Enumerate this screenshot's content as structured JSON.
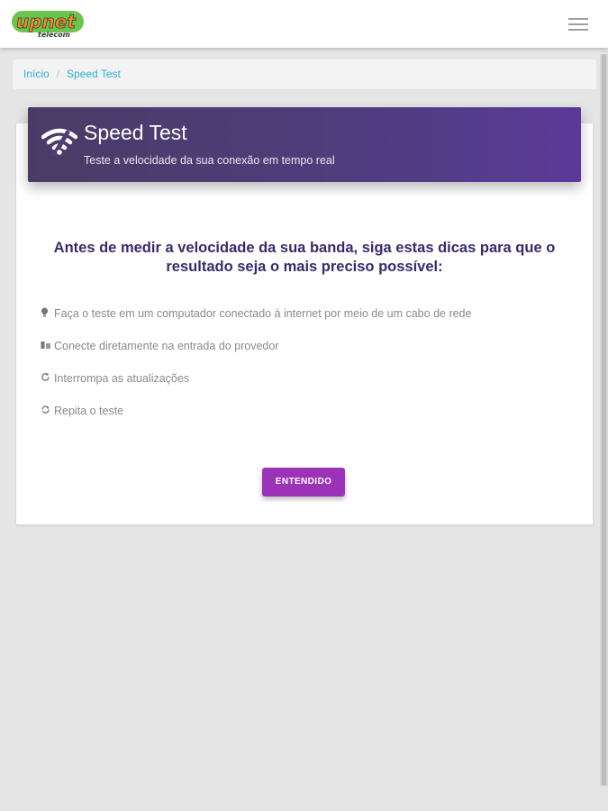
{
  "navbar": {
    "logo_text": "upnet",
    "logo_sub": "telecom",
    "menu_icon": "hamburger-menu-icon"
  },
  "breadcrumb": {
    "items": [
      "Início",
      "Speed Test"
    ],
    "separator": "/"
  },
  "card": {
    "header_icon": "wifi-icon",
    "title": "Speed Test",
    "subtitle": "Teste a velocidade da sua conexão em tempo real",
    "headline": "Antes de medir a velocidade da sua banda, siga estas dicas para que o resultado seja o mais preciso possível:",
    "tips": [
      {
        "icon": "lightbulb-icon",
        "text": "Faça o teste em um computador conectado à internet por meio de um cabo de rede"
      },
      {
        "icon": "network-icon",
        "text": "Conecte diretamente na entrada do provedor"
      },
      {
        "icon": "refresh-icon",
        "text": "Interrompa as atualizações"
      },
      {
        "icon": "repeat-icon",
        "text": "Repita o teste"
      }
    ],
    "button_label": "ENTENDIDO"
  },
  "colors": {
    "header_gradient_start": "#4a3b66",
    "header_gradient_end": "#5a3a98",
    "headline": "#3a2a6b",
    "button": "#9b32b8",
    "breadcrumb_link": "#2bb0d0",
    "logo_orange": "#f08a24",
    "logo_green": "#5bbf3a"
  }
}
